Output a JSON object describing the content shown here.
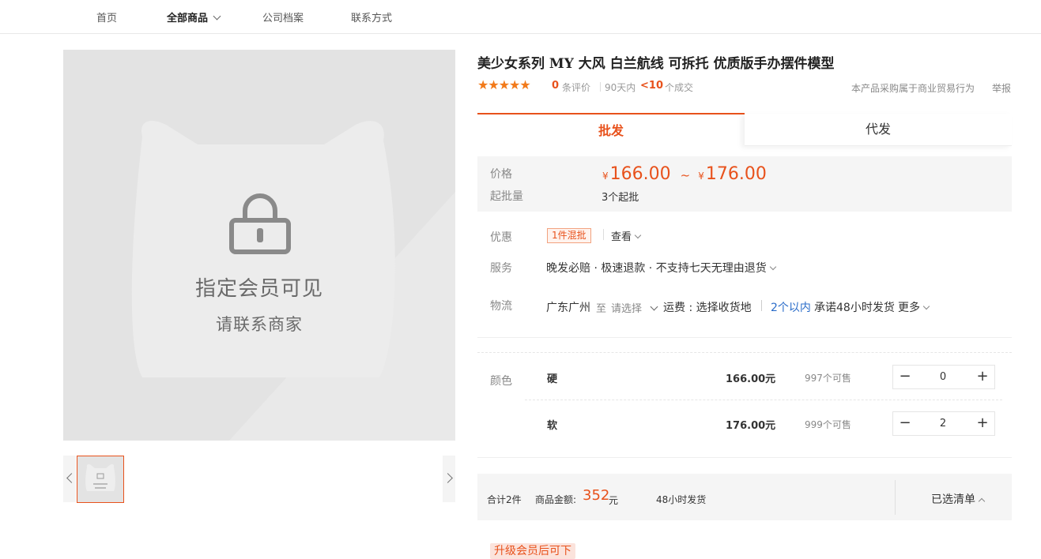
{
  "nav": {
    "items": [
      {
        "label": "首页",
        "active": false
      },
      {
        "label": "全部商品",
        "active": true
      },
      {
        "label": "公司档案",
        "active": false
      },
      {
        "label": "联系方式",
        "active": false
      }
    ]
  },
  "gallery": {
    "lock_title": "指定会员可见",
    "lock_subtitle": "请联系商家",
    "lock_icon": "lock-icon",
    "placeholder_color": "#e3e3e3"
  },
  "product": {
    "title": "美少女系列 MY 大风 白兰航线 可拆托 优质版手办摆件模型",
    "stars": "★★★★★",
    "review_count": "0",
    "review_label": "条评价",
    "days_label": "90天内",
    "deal_count": "<10",
    "deal_label": "个成交",
    "biz_note": "本产品采购属于商业贸易行为",
    "report": "举报"
  },
  "tabs": [
    {
      "label": "批发",
      "active": true
    },
    {
      "label": "代发",
      "active": false
    }
  ],
  "price": {
    "label": "价格",
    "currency": "¥",
    "min": "166.00",
    "tilde": "~",
    "max": "176.00",
    "min_batch_label": "起批量",
    "min_batch": "3个起批"
  },
  "promo": {
    "label": "优惠",
    "tag": "1件混批",
    "view": "查看"
  },
  "service": {
    "label": "服务",
    "text": "晚发必赔 · 极速退款 · 不支持七天无理由退货"
  },
  "logistics": {
    "label": "物流",
    "city": "广东广州",
    "to": "至",
    "select": "请选择",
    "fee": "运费 : 选择收货地",
    "time": "2个以内",
    "promise": "承诺48小时发货",
    "more": "更多"
  },
  "sku": {
    "label": "颜色",
    "rows": [
      {
        "name": "硬",
        "price": "166.00元",
        "stock": "997个可售",
        "qty": "0"
      },
      {
        "name": "软",
        "price": "176.00元",
        "stock": "999个可售",
        "qty": "2"
      }
    ],
    "minus": "−",
    "plus": "+"
  },
  "summary": {
    "total": "合计2件",
    "amount_label": "商品金额:",
    "amount": "352",
    "unit": "元",
    "ship": "48小时发货",
    "list": "已选清单"
  },
  "upgrade": "升级会员后可下",
  "colors": {
    "accent": "#e8521c",
    "star": "#f27a1a",
    "link": "#2a6cc9"
  }
}
